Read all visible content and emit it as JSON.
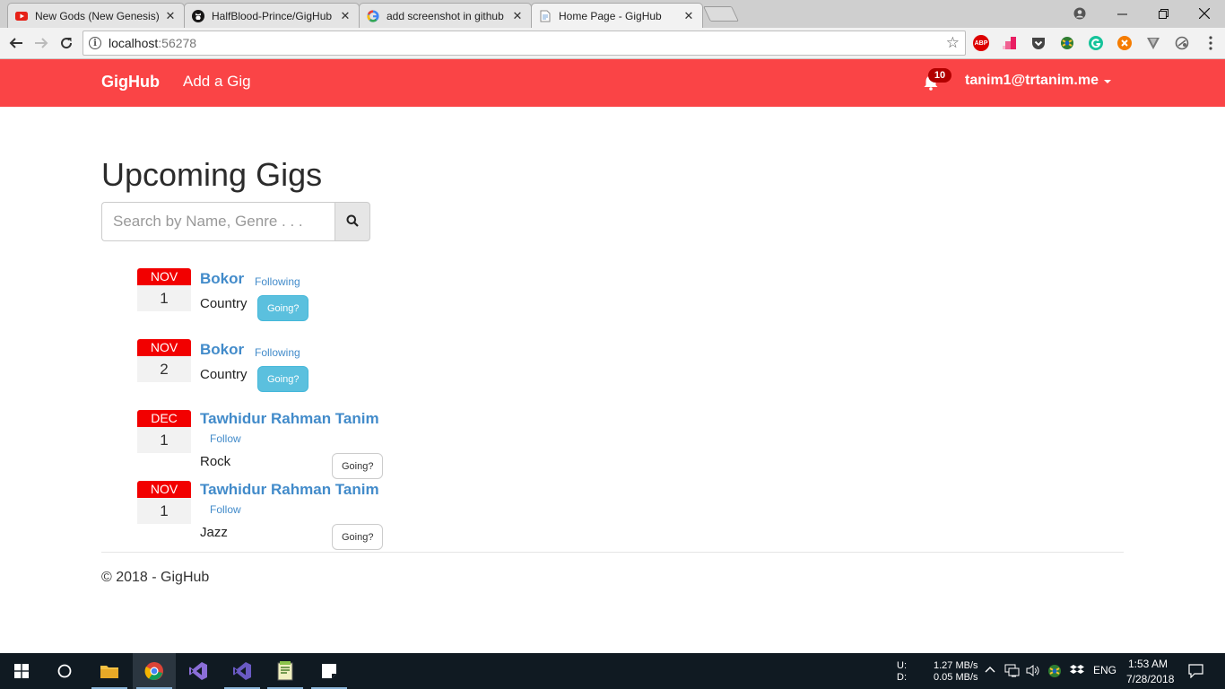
{
  "browser": {
    "tabs": [
      {
        "title": "New Gods (New Genesis)",
        "icon": "youtube-icon",
        "active": false
      },
      {
        "title": "HalfBlood-Prince/GigHub",
        "icon": "github-icon",
        "active": false
      },
      {
        "title": "add screenshot in github",
        "icon": "google-icon",
        "active": false
      },
      {
        "title": "Home Page - GigHub",
        "icon": "page-icon",
        "active": true
      }
    ],
    "url_host": "localhost",
    "url_port": ":56278",
    "extensions": [
      "adblock-plus-icon",
      "pink-extension-icon",
      "pocket-icon",
      "extension-globe-icon",
      "grammarly-icon",
      "orange-extension-icon",
      "vimium-icon",
      "toggle-extension-icon"
    ],
    "adblock_label": "ABP"
  },
  "navbar": {
    "brand": "GigHub",
    "add_gig": "Add a Gig",
    "notification_count": "10",
    "user_email": "tanim1@trtanim.me"
  },
  "main": {
    "title": "Upcoming Gigs",
    "search_placeholder": "Search by Name, Genre . . .",
    "gigs": [
      {
        "month": "NOV",
        "day": "1",
        "artist": "Bokor",
        "follow_label": "Following",
        "genre": "Country",
        "going_label": "Going?",
        "going_active": true
      },
      {
        "month": "NOV",
        "day": "2",
        "artist": "Bokor",
        "follow_label": "Following",
        "genre": "Country",
        "going_label": "Going?",
        "going_active": true
      },
      {
        "month": "DEC",
        "day": "1",
        "artist": "Tawhidur Rahman Tanim",
        "follow_label": "Follow",
        "genre": "Rock",
        "going_label": "Going?",
        "going_active": false
      },
      {
        "month": "NOV",
        "day": "1",
        "artist": "Tawhidur Rahman Tanim",
        "follow_label": "Follow",
        "genre": "Jazz",
        "going_label": "Going?",
        "going_active": false
      }
    ]
  },
  "footer": {
    "text": "© 2018 - GigHub"
  },
  "taskbar": {
    "upload_label": "U:",
    "download_label": "D:",
    "upload_speed": "1.27 MB/s",
    "download_speed": "0.05 MB/s",
    "language": "ENG",
    "time": "1:53 AM",
    "date": "7/28/2018"
  }
}
